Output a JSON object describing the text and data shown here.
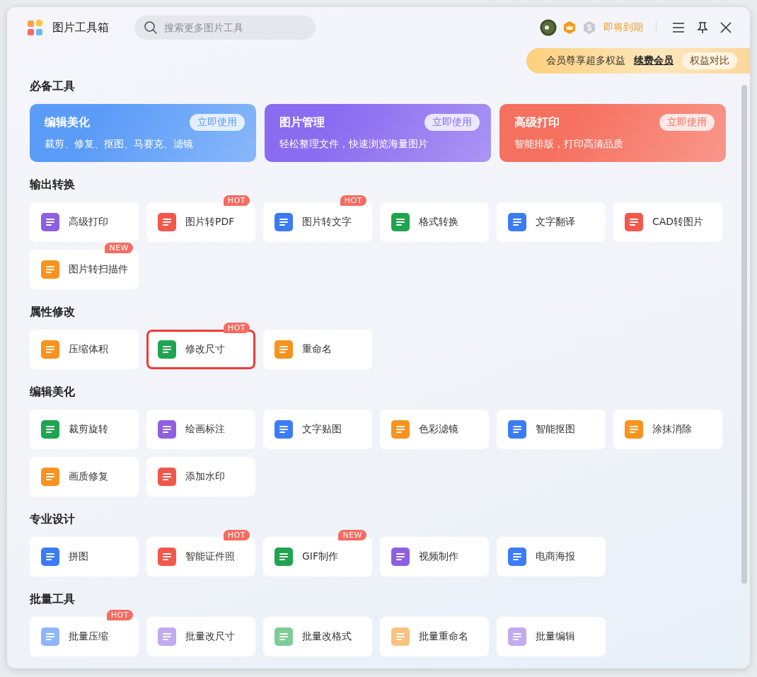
{
  "header": {
    "app_title": "图片工具箱",
    "search": {
      "placeholder": "搜索更多图片工具"
    },
    "status": "即将到期"
  },
  "promo": {
    "text": "会员尊享超多权益",
    "link": "续费会员",
    "button": "权益对比"
  },
  "sections": [
    {
      "title": "必备工具",
      "kind": "feature",
      "cards": [
        {
          "title": "编辑美化",
          "subtitle": "裁剪、修复、抠图、马赛克、滤镜",
          "button": "立即使用",
          "color": "#5b9cf8"
        },
        {
          "title": "图片管理",
          "subtitle": "轻松整理文件，快速浏览海量图片",
          "button": "立即使用",
          "color": "#8a6cf0"
        },
        {
          "title": "高级打印",
          "subtitle": "智能排版，打印高清品质",
          "button": "立即使用",
          "color": "#f6705f"
        }
      ]
    },
    {
      "title": "输出转换",
      "kind": "tools",
      "tools": [
        {
          "label": "高级打印",
          "color": "#8e5fe0",
          "highlighted": false
        },
        {
          "label": "图片转PDF",
          "badge": "HOT",
          "color": "#f2574b",
          "highlighted": false
        },
        {
          "label": "图片转文字",
          "badge": "HOT",
          "color": "#3b7cf5",
          "highlighted": false
        },
        {
          "label": "格式转换",
          "color": "#1fa44f",
          "highlighted": false
        },
        {
          "label": "文字翻译",
          "color": "#3b7cf5",
          "highlighted": false
        },
        {
          "label": "CAD转图片",
          "color": "#f2574b",
          "highlighted": false
        },
        {
          "label": "图片转扫描件",
          "badge": "NEW",
          "color": "#f7931e",
          "highlighted": false
        }
      ]
    },
    {
      "title": "属性修改",
      "kind": "tools",
      "tools": [
        {
          "label": "压缩体积",
          "color": "#f7931e",
          "highlighted": false
        },
        {
          "label": "修改尺寸",
          "badge": "HOT",
          "color": "#1fa44f",
          "highlighted": true
        },
        {
          "label": "重命名",
          "color": "#f7931e",
          "highlighted": false
        }
      ]
    },
    {
      "title": "编辑美化",
      "kind": "tools",
      "tools": [
        {
          "label": "裁剪旋转",
          "color": "#1fa44f",
          "highlighted": false
        },
        {
          "label": "绘画标注",
          "color": "#8e5fe0",
          "highlighted": false
        },
        {
          "label": "文字贴图",
          "color": "#3b7cf5",
          "highlighted": false
        },
        {
          "label": "色彩滤镜",
          "color": "#f7931e",
          "highlighted": false
        },
        {
          "label": "智能抠图",
          "color": "#3b7cf5",
          "highlighted": false
        },
        {
          "label": "涂抹消除",
          "color": "#f7931e",
          "highlighted": false
        },
        {
          "label": "画质修复",
          "color": "#f7931e",
          "highlighted": false
        },
        {
          "label": "添加水印",
          "color": "#f2574b",
          "highlighted": false
        }
      ]
    },
    {
      "title": "专业设计",
      "kind": "tools",
      "tools": [
        {
          "label": "拼图",
          "color": "#3b7cf5",
          "highlighted": false
        },
        {
          "label": "智能证件照",
          "badge": "HOT",
          "color": "#f2574b",
          "highlighted": false
        },
        {
          "label": "GIF制作",
          "badge": "NEW",
          "color": "#1fa44f",
          "highlighted": false
        },
        {
          "label": "视频制作",
          "color": "#8e5fe0",
          "highlighted": false
        },
        {
          "label": "电商海报",
          "color": "#3b7cf5",
          "highlighted": false
        }
      ]
    },
    {
      "title": "批量工具",
      "kind": "tools",
      "tools": [
        {
          "label": "批量压缩",
          "badge": "HOT",
          "color": "#8fb6f8",
          "highlighted": false
        },
        {
          "label": "批量改尺寸",
          "color": "#c2aaf0",
          "highlighted": false
        },
        {
          "label": "批量改格式",
          "color": "#7dcc98",
          "highlighted": false
        },
        {
          "label": "批量重命名",
          "color": "#f9c27e",
          "highlighted": false
        },
        {
          "label": "批量编辑",
          "color": "#c2aaf0",
          "highlighted": false
        }
      ]
    }
  ]
}
